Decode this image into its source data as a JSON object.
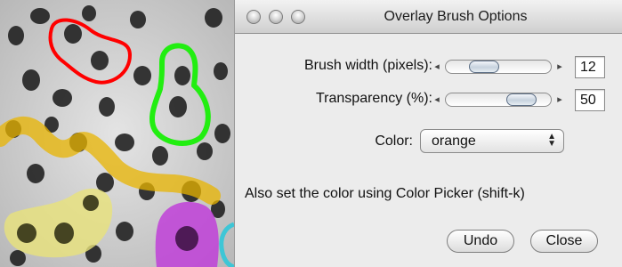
{
  "window": {
    "title": "Overlay Brush Options"
  },
  "brush_width": {
    "label": "Brush width (pixels):",
    "value": "12",
    "slider_fraction": 0.35
  },
  "transparency": {
    "label": "Transparency (%):",
    "value": "50",
    "slider_fraction": 0.75
  },
  "color": {
    "label": "Color:",
    "selected": "orange"
  },
  "info_text": "Also set the color using Color Picker (shift-k)",
  "buttons": {
    "undo": "Undo",
    "close": "Close"
  },
  "icons": {
    "left_arrow": "◂",
    "right_arrow": "▸",
    "select_chevron": "⬍"
  },
  "overlay_colors": {
    "red": "#ff0000",
    "green": "#22ee11",
    "orange": "#e8b400",
    "yellow": "#e8e27a",
    "magenta": "#c040d8",
    "cyan": "#3ec6d6"
  }
}
